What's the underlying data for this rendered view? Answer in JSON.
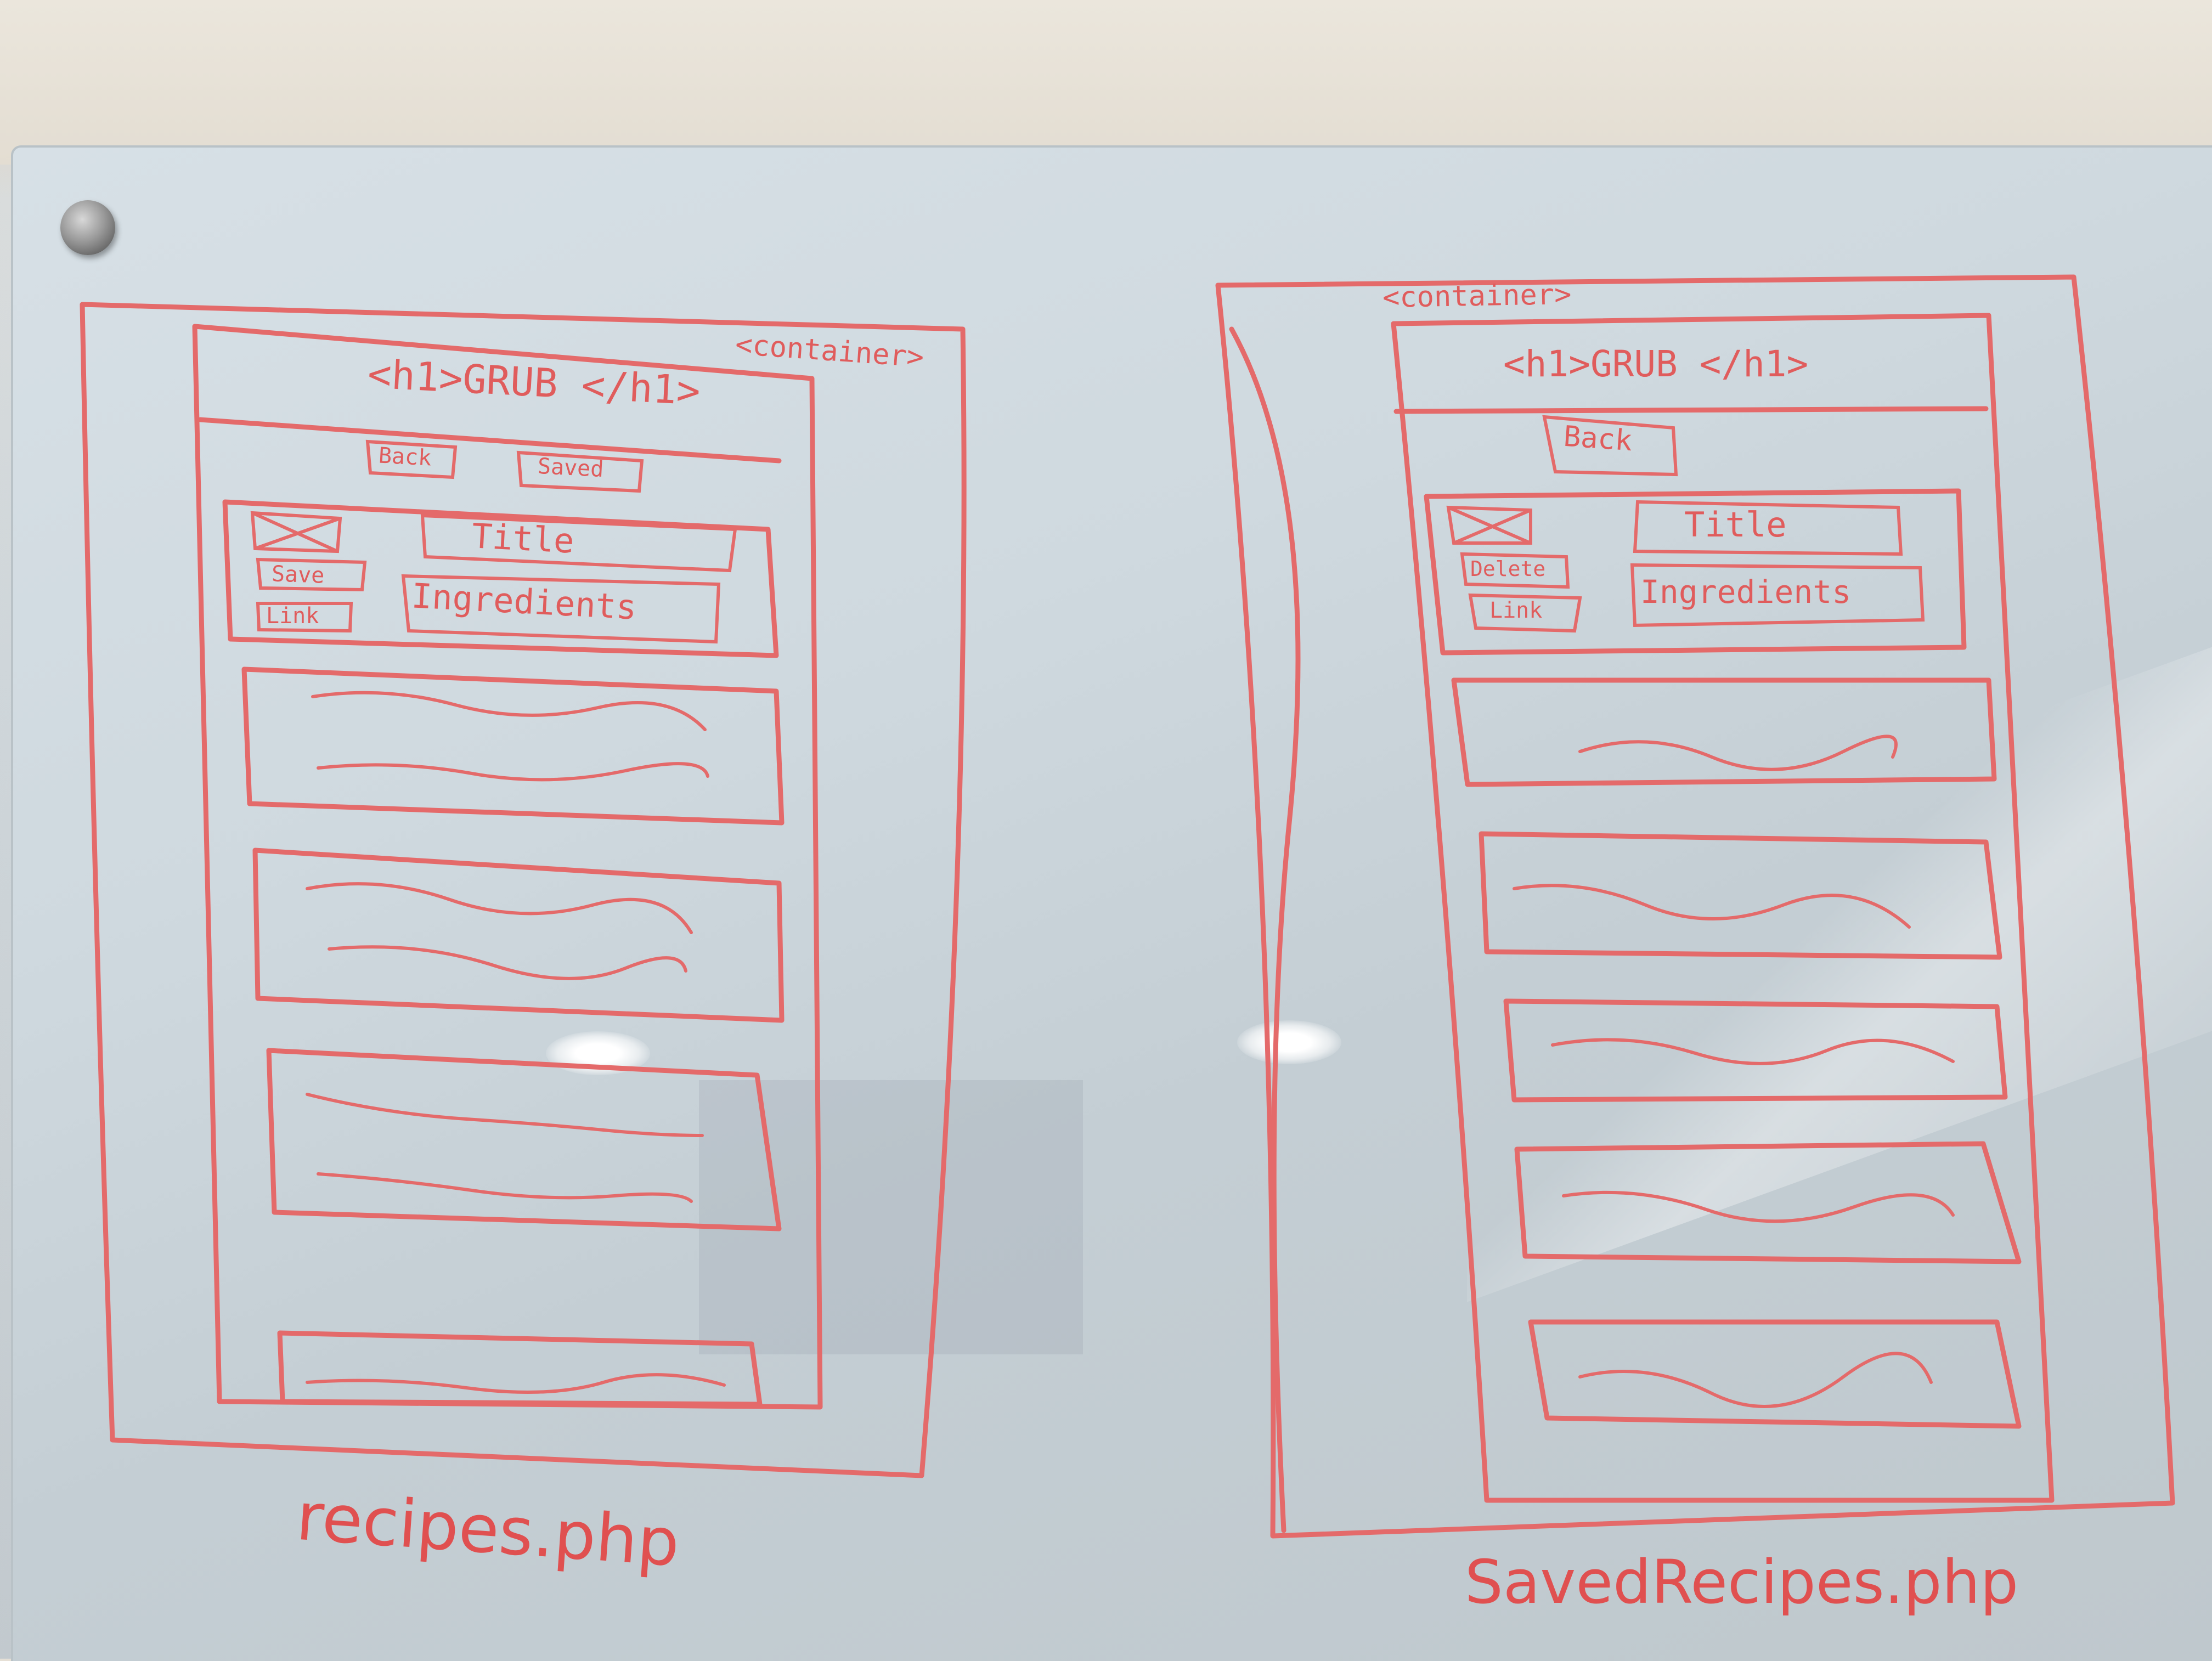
{
  "left_sketch": {
    "container_tag": "<container>",
    "heading": "<h1>GRUB </h1>",
    "back_button": "Back",
    "saved_button": "Saved",
    "title_field": "Title",
    "ingredients_field": "Ingredients",
    "save_button": "Save",
    "link_button": "Link",
    "caption": "recipes.php"
  },
  "right_sketch": {
    "container_tag": "<container>",
    "heading": "<h1>GRUB </h1>",
    "back_button": "Back",
    "title_field": "Title",
    "ingredients_field": "Ingredients",
    "delete_button": "Delete",
    "link_button": "Link",
    "caption": "SavedRecipes.php"
  }
}
